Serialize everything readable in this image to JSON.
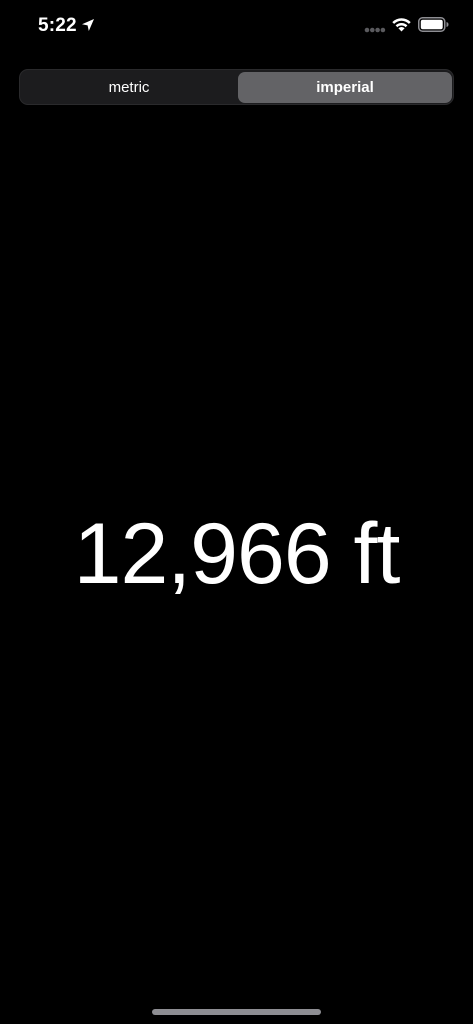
{
  "status_bar": {
    "time": "5:22",
    "icons": {
      "location": "location-arrow-icon",
      "signal": "cellular-signal-icon",
      "wifi": "wifi-icon",
      "battery": "battery-icon"
    }
  },
  "segmented_control": {
    "options": [
      "metric",
      "imperial"
    ],
    "selected": "imperial"
  },
  "altitude": {
    "display": "12,966 ft"
  },
  "colors": {
    "background": "#000000",
    "text": "#ffffff",
    "segment_track": "#1c1c1e",
    "segment_selected": "#636366",
    "home_indicator": "#8e8e93"
  }
}
